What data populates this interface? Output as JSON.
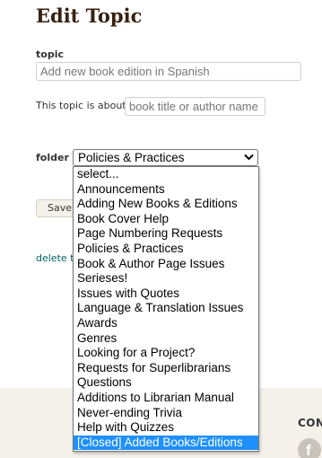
{
  "page": {
    "title": "Edit Topic"
  },
  "form": {
    "topic_label": "topic",
    "topic_value": "Add new book edition in Spanish",
    "about_label": "This topic is about",
    "about_placeholder": "book title or author name",
    "folder_label": "folder",
    "folder_selected": "Policies & Practices",
    "folder_options": [
      "select...",
      "Announcements",
      "Adding New Books & Editions",
      "Book Cover Help",
      "Page Numbering Requests",
      "Policies & Practices",
      "Book & Author Page Issues",
      "Serieses!",
      "Issues with Quotes",
      "Language & Translation Issues",
      "Awards",
      "Genres",
      "Looking for a Project?",
      "Requests for Superlibrarians",
      "Questions",
      "Additions to Librarian Manual",
      "Never-ending Trivia",
      "Help with Quizzes",
      "[Closed] Added Books/Editions"
    ],
    "highlighted_option": "[Closed] Added Books/Editions",
    "save_label": "Save",
    "delete_label": "delete t"
  },
  "footer": {
    "heading": "CON",
    "social_icon_letter": "f"
  },
  "colors": {
    "title": "#382110",
    "link": "#00635d",
    "highlight": "#1e90ff",
    "footer_bg": "#f4f1ea"
  }
}
